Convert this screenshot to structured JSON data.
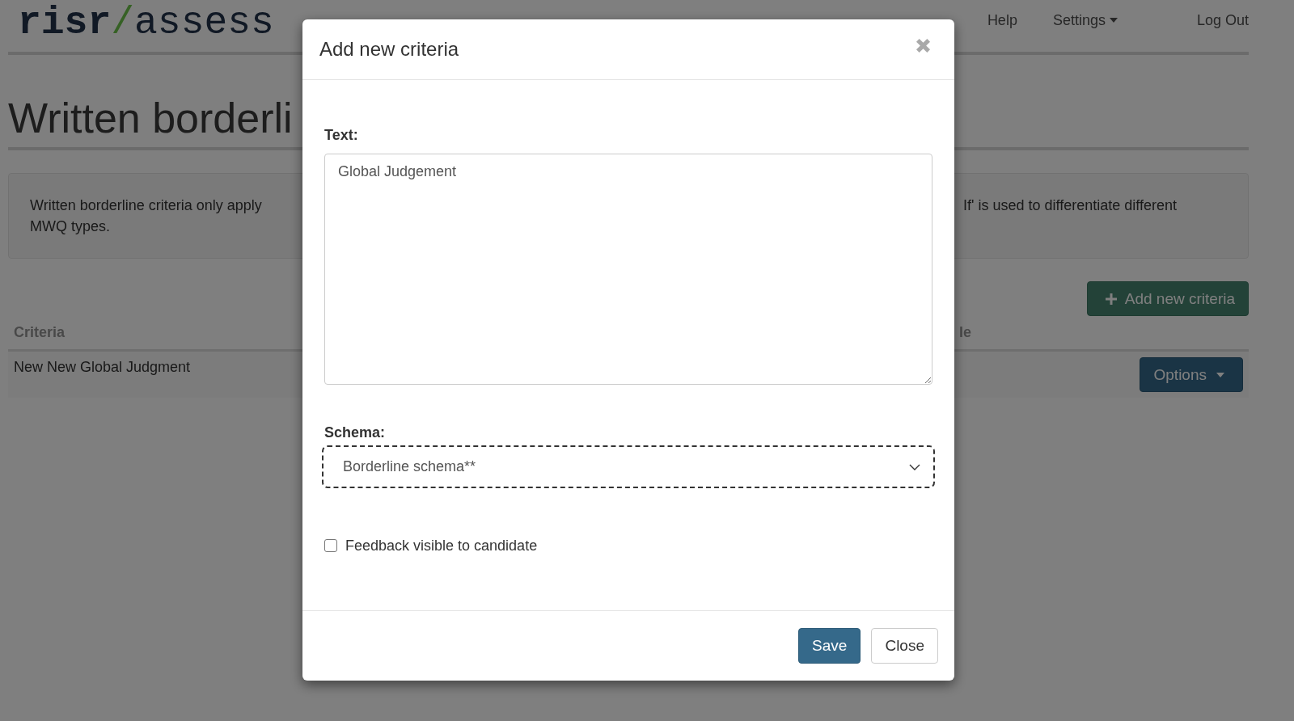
{
  "header": {
    "logo": {
      "prefix": "risr",
      "separator": "/",
      "suffix": "assess"
    },
    "nav": [
      {
        "label": "Help",
        "kind": "link"
      },
      {
        "label": "Settings",
        "kind": "dropdown"
      }
    ],
    "logout": "Log Out"
  },
  "page": {
    "title": "Written borderli",
    "info": {
      "left_lines": [
        "Written borderline criteria only apply",
        "MWQ types."
      ],
      "right_lines": [
        "If' is used to differentiate different"
      ]
    },
    "add_button": "Add new criteria",
    "table": {
      "columns": [
        "Criteria",
        "le"
      ],
      "rows": [
        {
          "criteria": "New New Global Judgment",
          "action": "Options"
        }
      ]
    }
  },
  "modal": {
    "title": "Add new criteria",
    "text_field": {
      "label": "Text:",
      "value": "Global Judgement"
    },
    "schema_field": {
      "label": "Schema:",
      "value": "Borderline schema**",
      "focused": true
    },
    "feedback_checkbox": {
      "label": "Feedback visible to candidate",
      "checked": false
    },
    "buttons": [
      {
        "label": "Save",
        "kind": "primary"
      },
      {
        "label": "Close",
        "kind": "default"
      }
    ]
  }
}
